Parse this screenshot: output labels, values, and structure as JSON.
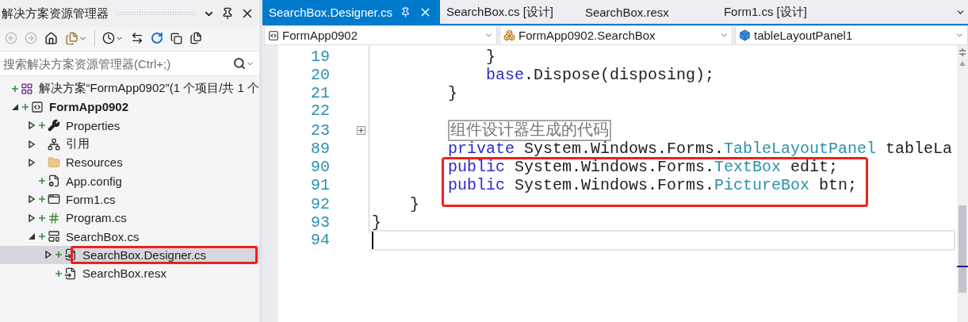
{
  "explorer": {
    "title": "解决方案资源管理器",
    "search": {
      "placeholder": "搜索解决方案资源管理器(Ctrl+;)"
    },
    "tree": [
      {
        "label": "解决方案“FormApp0902”(1 个项目/共 1 个",
        "kind": "solution",
        "added": true,
        "selected": false,
        "outlined": false,
        "children": [
          {
            "label": "FormApp0902",
            "kind": "project",
            "expanded": true,
            "added": true,
            "selected": false,
            "outlined": false,
            "children": [
              {
                "label": "Properties",
                "kind": "properties",
                "expanded": false,
                "added": true,
                "selected": false,
                "outlined": false
              },
              {
                "label": "引用",
                "kind": "references",
                "expanded": false,
                "added": false,
                "selected": false,
                "outlined": false
              },
              {
                "label": "Resources",
                "kind": "folder",
                "expanded": false,
                "added": false,
                "selected": false,
                "outlined": false
              },
              {
                "label": "App.config",
                "kind": "config",
                "added": true,
                "selected": false,
                "outlined": false
              },
              {
                "label": "Form1.cs",
                "kind": "form",
                "expanded": false,
                "added": true,
                "selected": false,
                "outlined": false
              },
              {
                "label": "Program.cs",
                "kind": "csharp",
                "expanded": false,
                "added": true,
                "selected": false,
                "outlined": false
              },
              {
                "label": "SearchBox.cs",
                "kind": "usercontrol",
                "expanded": true,
                "added": true,
                "selected": false,
                "outlined": false,
                "children": [
                  {
                    "label": "SearchBox.Designer.cs",
                    "kind": "designer",
                    "expanded": false,
                    "added": true,
                    "selected": true,
                    "outlined": true
                  },
                  {
                    "label": "SearchBox.resx",
                    "kind": "designer",
                    "added": true,
                    "selected": false,
                    "outlined": false
                  }
                ]
              }
            ]
          }
        ]
      }
    ]
  },
  "editor": {
    "tabs": [
      {
        "label": "SearchBox.Designer.cs",
        "selected": true
      },
      {
        "label": "SearchBox.cs [设计]",
        "selected": false
      },
      {
        "label": "SearchBox.resx",
        "selected": false
      },
      {
        "label": "Form1.cs [设计]",
        "selected": false
      }
    ],
    "navigation": [
      {
        "label": "FormApp0902",
        "kind": "project"
      },
      {
        "label": "FormApp0902.SearchBox",
        "kind": "class"
      },
      {
        "label": "tableLayoutPanel1",
        "kind": "field"
      }
    ],
    "lines": [
      {
        "number": "19",
        "outlined": false,
        "tokens": [
          {
            "kind": "text",
            "text": "            }"
          }
        ]
      },
      {
        "number": "20",
        "outlined": false,
        "tokens": [
          {
            "kind": "keyword",
            "text": "            base"
          },
          {
            "kind": "text",
            "text": ".Dispose(disposing);"
          }
        ]
      },
      {
        "number": "21",
        "outlined": false,
        "tokens": [
          {
            "kind": "text",
            "text": "        }"
          }
        ]
      },
      {
        "number": "22",
        "outlined": false
      },
      {
        "number": "23",
        "outlined": false,
        "collapsed": true,
        "tokens": [
          {
            "kind": "region",
            "text": "        组件设计器生成的代码"
          }
        ]
      },
      {
        "number": "89",
        "outlined": false,
        "tokens": [
          {
            "kind": "keyword",
            "text": "        private"
          },
          {
            "kind": "text",
            "text": " System.Windows.Forms."
          },
          {
            "kind": "type",
            "text": "TableLayoutPanel"
          },
          {
            "kind": "text",
            "text": " tableLa"
          }
        ]
      },
      {
        "number": "90",
        "outlined": true,
        "tokens": [
          {
            "kind": "keyword",
            "text": "        public"
          },
          {
            "kind": "text",
            "text": " System.Windows.Forms."
          },
          {
            "kind": "type",
            "text": "TextBox"
          },
          {
            "kind": "text",
            "text": " edit;"
          }
        ]
      },
      {
        "number": "91",
        "outlined": true,
        "tokens": [
          {
            "kind": "keyword",
            "text": "        public"
          },
          {
            "kind": "text",
            "text": " System.Windows.Forms."
          },
          {
            "kind": "type",
            "text": "PictureBox"
          },
          {
            "kind": "text",
            "text": " btn;"
          }
        ]
      },
      {
        "number": "92",
        "outlined": false,
        "tokens": [
          {
            "kind": "text",
            "text": "    }"
          }
        ]
      },
      {
        "number": "93",
        "outlined": false,
        "tokens": [
          {
            "kind": "text",
            "text": "}"
          }
        ]
      },
      {
        "number": "94",
        "outlined": false,
        "current": true
      }
    ]
  }
}
